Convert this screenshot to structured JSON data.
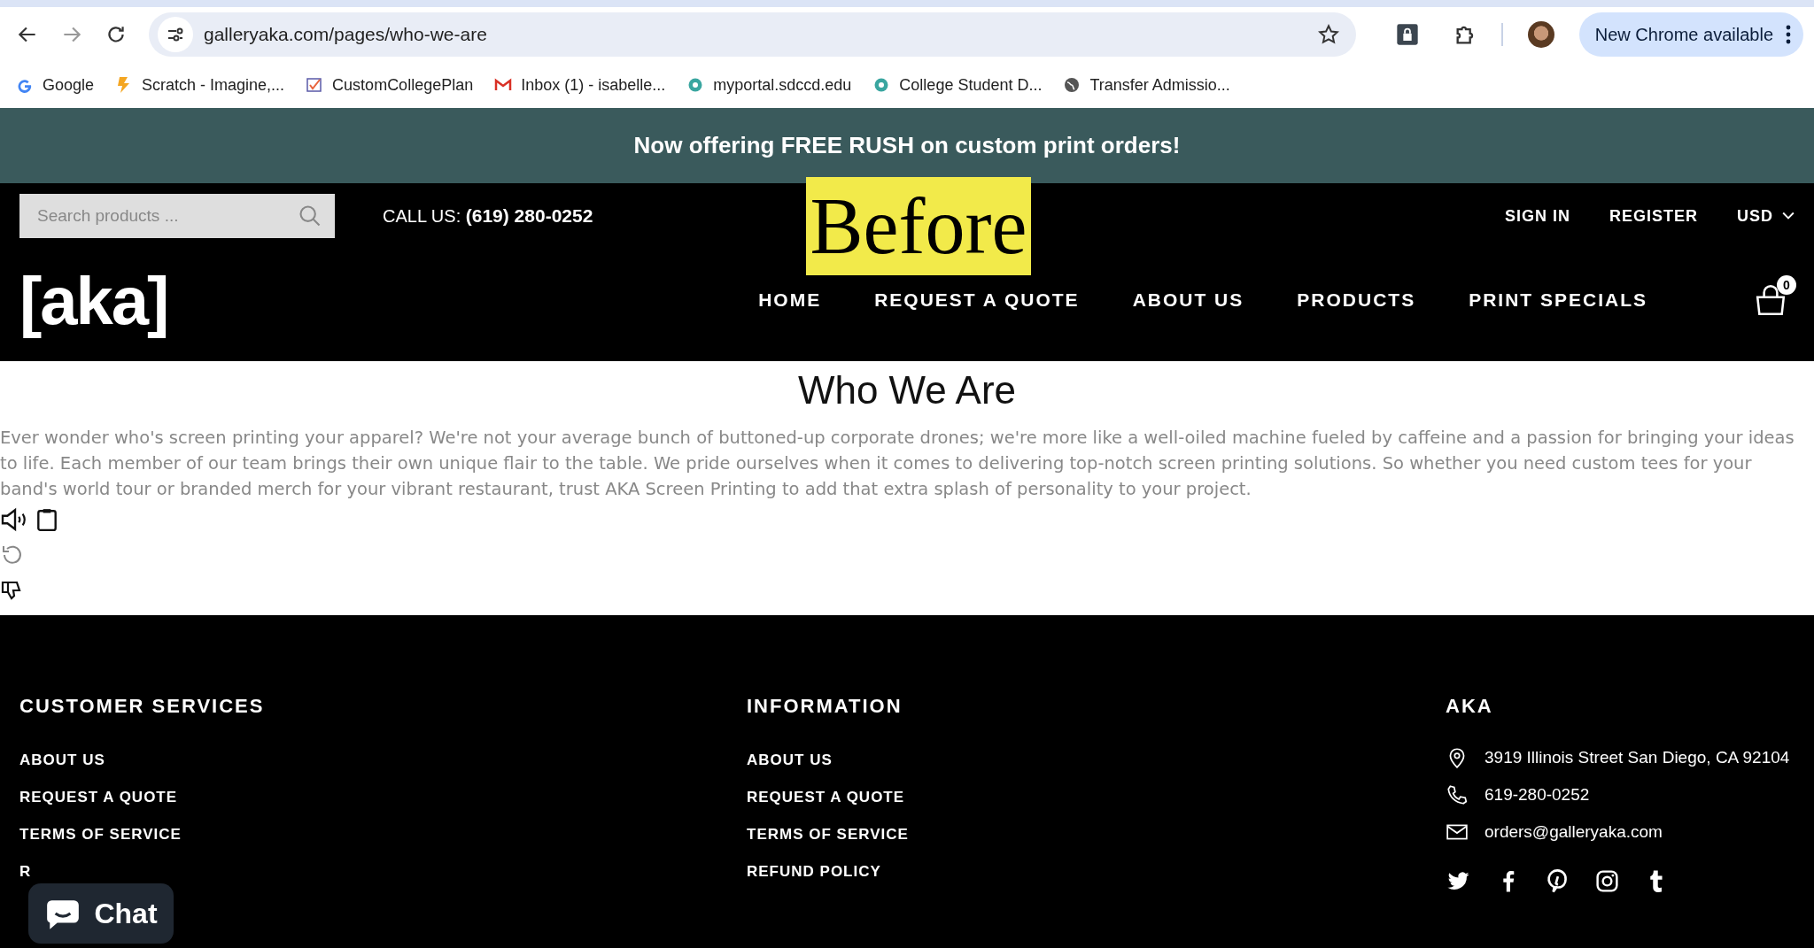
{
  "browser": {
    "url": "galleryaka.com/pages/who-we-are",
    "update_button": "New Chrome available",
    "bookmarks": [
      {
        "label": "Google",
        "kind": "google"
      },
      {
        "label": "Scratch - Imagine,...",
        "kind": "scratch"
      },
      {
        "label": "CustomCollegePlan",
        "kind": "check"
      },
      {
        "label": "Inbox (1) - isabelle...",
        "kind": "mail"
      },
      {
        "label": "myportal.sdccd.edu",
        "kind": "portal"
      },
      {
        "label": "College Student D...",
        "kind": "portal"
      },
      {
        "label": "Transfer Admissio...",
        "kind": "globe"
      }
    ]
  },
  "announcement": "Now offering FREE RUSH on custom print orders!",
  "header": {
    "search": {
      "placeholder": "Search products ..."
    },
    "call_label": "CALL US:",
    "phone": "(619) 280-0252",
    "account_links": [
      "SIGN IN",
      "REGISTER"
    ],
    "currency": "USD",
    "logo": "[aka]",
    "nav": [
      "HOME",
      "REQUEST A QUOTE",
      "ABOUT US",
      "PRODUCTS",
      "PRINT SPECIALS"
    ],
    "cart_count": "0"
  },
  "annotation": "Before",
  "content": {
    "title": "Who We Are",
    "body": "Ever wonder who's screen printing your apparel? We're not your average bunch of buttoned-up corporate drones; we're more like a well-oiled machine fueled by caffeine and a passion for bringing your ideas to life. Each member of our team brings their own unique flair to the table. We pride ourselves when it comes to delivering top-notch screen printing solutions. So whether you need custom tees for your band's world tour or branded merch for your vibrant restaurant, trust AKA Screen Printing to add that extra splash of personality to your project."
  },
  "footer": {
    "columns": [
      {
        "heading": "CUSTOMER SERVICES",
        "links": [
          "ABOUT US",
          "REQUEST A QUOTE",
          "TERMS OF SERVICE",
          "R"
        ]
      },
      {
        "heading": "INFORMATION",
        "links": [
          "ABOUT US",
          "REQUEST A QUOTE",
          "TERMS OF SERVICE",
          "REFUND POLICY"
        ]
      }
    ],
    "contact": {
      "heading": "AKA",
      "items": [
        {
          "kind": "address",
          "text": "3919 Illinois Street San Diego, CA 92104"
        },
        {
          "kind": "phone",
          "text": "619-280-0252"
        },
        {
          "kind": "email",
          "text": "orders@galleryaka.com"
        }
      ]
    }
  },
  "chat": {
    "label": "Chat"
  }
}
